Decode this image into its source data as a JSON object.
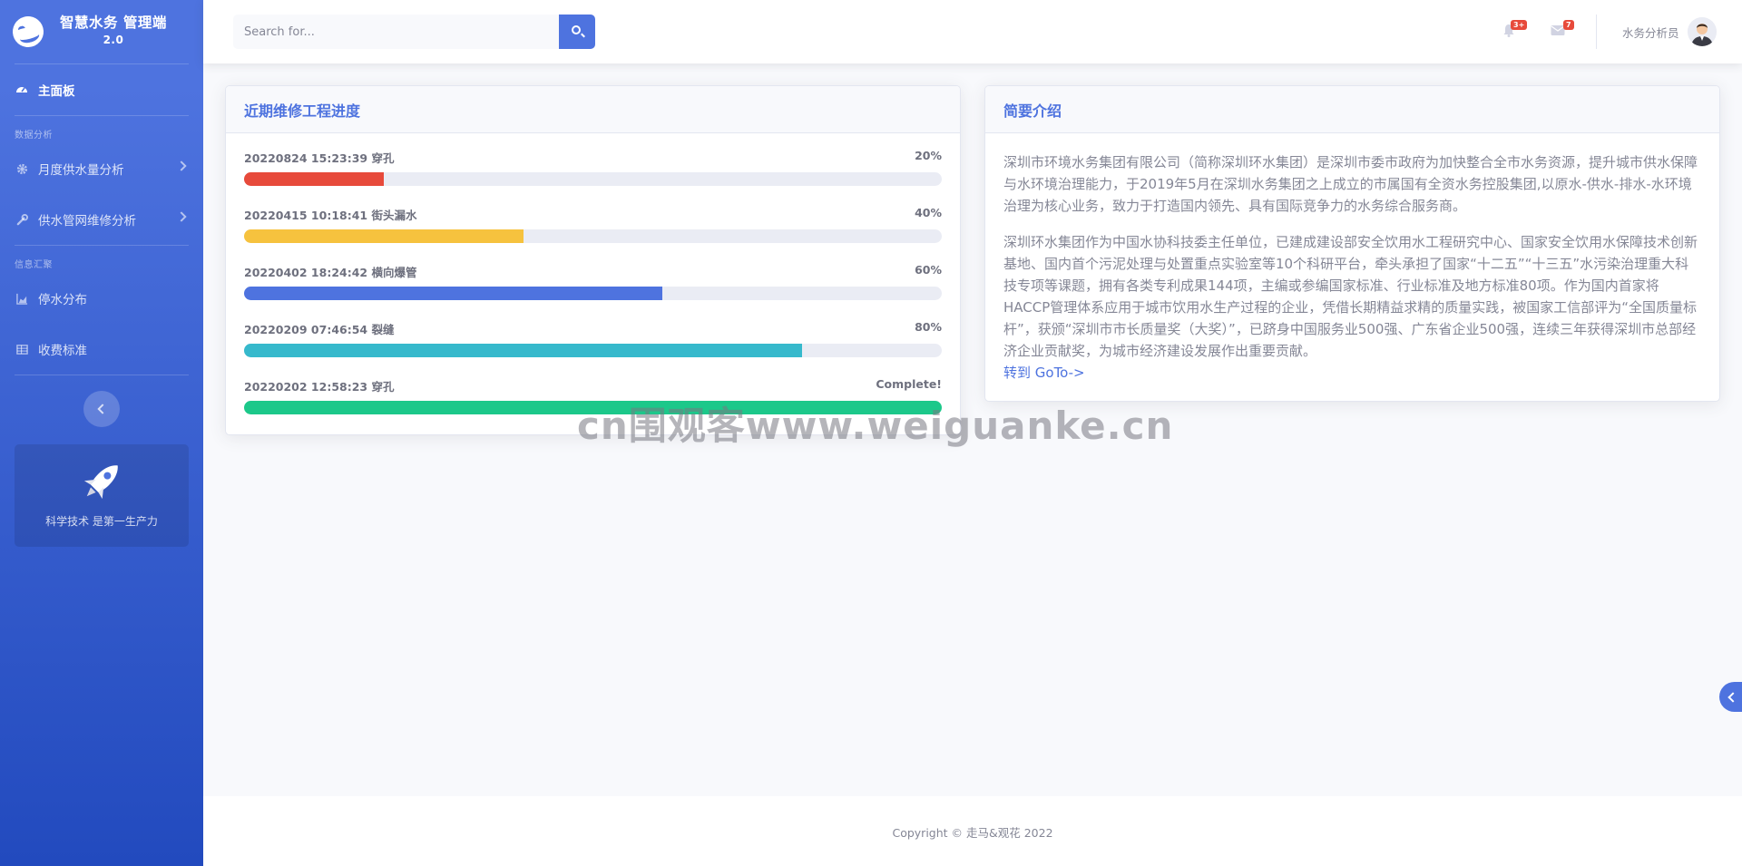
{
  "brand": {
    "title": "智慧水务 管理端",
    "version": "2.0",
    "icon": "laugh-wink-icon"
  },
  "sidebar": {
    "dashboard": {
      "label": "主面板",
      "icon": "tachometer-icon"
    },
    "section1": "数据分析",
    "items1": [
      {
        "label": "月度供水量分析",
        "icon": "cog-icon"
      },
      {
        "label": "供水管网维修分析",
        "icon": "wrench-icon"
      }
    ],
    "section2": "信息汇聚",
    "items2": [
      {
        "label": "停水分布",
        "icon": "chart-area-icon"
      },
      {
        "label": "收费标准",
        "icon": "table-icon"
      }
    ],
    "promo_text": "科学技术 是第一生产力"
  },
  "topbar": {
    "search_placeholder": "Search for...",
    "alerts_badge": "3+",
    "messages_badge": "7",
    "user_name": "水务分析员"
  },
  "progress_card": {
    "title": "近期维修工程进度",
    "items": [
      {
        "label": "20220824 15:23:39 穿孔",
        "percent_text": "20%",
        "value": 20,
        "color": "#e74a3b"
      },
      {
        "label": "20220415 10:18:41 街头漏水",
        "percent_text": "40%",
        "value": 40,
        "color": "#f6c23e"
      },
      {
        "label": "20220402 18:24:42 横向爆管",
        "percent_text": "60%",
        "value": 60,
        "color": "#4e73df"
      },
      {
        "label": "20220209 07:46:54 裂缝",
        "percent_text": "80%",
        "value": 80,
        "color": "#36b9cc"
      },
      {
        "label": "20220202 12:58:23 穿孔",
        "percent_text": "Complete!",
        "value": 100,
        "color": "#1cc88a"
      }
    ]
  },
  "intro_card": {
    "title": "简要介绍",
    "para1": "深圳市环境水务集团有限公司（简称深圳环水集团）是深圳市委市政府为加快整合全市水务资源，提升城市供水保障与水环境治理能力，于2019年5月在深圳水务集团之上成立的市属国有全资水务控股集团,以原水-供水-排水-水环境治理为核心业务，致力于打造国内领先、具有国际竞争力的水务综合服务商。",
    "para2": "深圳环水集团作为中国水协科技委主任单位，已建成建设部安全饮用水工程研究中心、国家安全饮用水保障技术创新基地、国内首个污泥处理与处置重点实验室等10个科研平台，牵头承担了国家“十二五”“十三五”水污染治理重大科技专项等课题，拥有各类专利成果144项，主编或参编国家标准、行业标准及地方标准80项。作为国内首家将HACCP管理体系应用于城市饮用水生产过程的企业，凭借长期精益求精的质量实践，被国家工信部评为“全国质量标杆”，获颁“深圳市市长质量奖（大奖）”，已跻身中国服务业500强、广东省企业500强，连续三年获得深圳市总部经济企业贡献奖，为城市经济建设发展作出重要贡献。",
    "link": "转到 GoTo->"
  },
  "watermark": "cn围观客www.weiguanke.cn",
  "footer": "Copyright © 走马&观花 2022"
}
